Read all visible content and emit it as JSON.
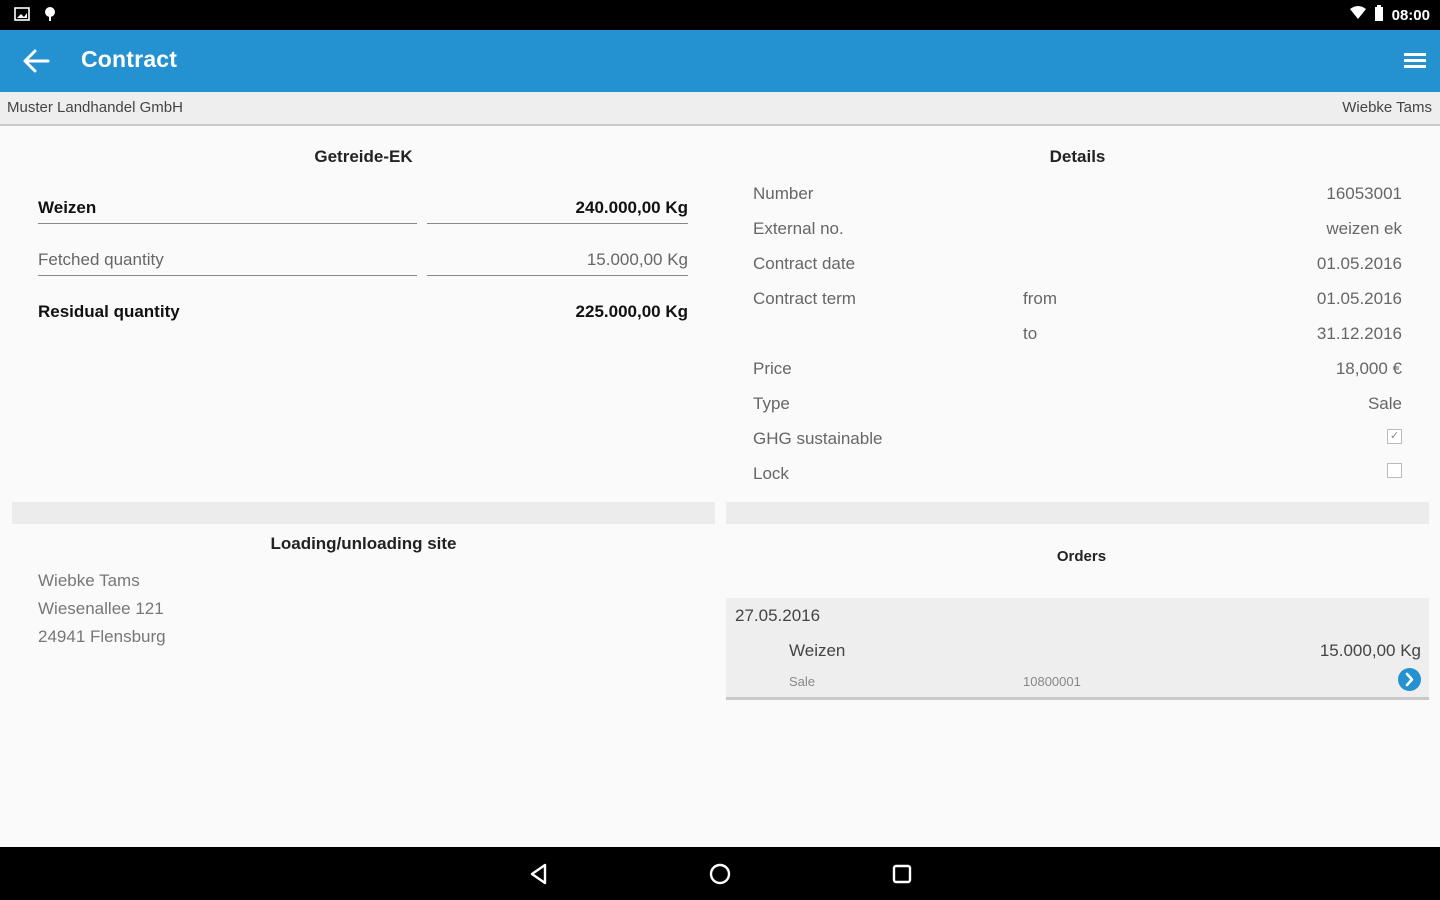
{
  "status_bar": {
    "time": "08:00"
  },
  "app_bar": {
    "title": "Contract"
  },
  "sub_header": {
    "company": "Muster Landhandel GmbH",
    "user": "Wiebke Tams"
  },
  "contract": {
    "title": "Getreide-EK",
    "product_label": "Weizen",
    "product_quantity": "240.000,00 Kg",
    "fetched_label": "Fetched quantity",
    "fetched_quantity": "15.000,00 Kg",
    "residual_label": "Residual quantity",
    "residual_quantity": "225.000,00 Kg"
  },
  "details": {
    "title": "Details",
    "number_label": "Number",
    "number_value": "16053001",
    "external_label": "External no.",
    "external_value": "weizen ek",
    "date_label": "Contract date",
    "date_value": "01.05.2016",
    "term_label": "Contract term",
    "from_label": "from",
    "from_value": "01.05.2016",
    "to_label": "to",
    "to_value": "31.12.2016",
    "price_label": "Price",
    "price_value": "18,000 €",
    "type_label": "Type",
    "type_value": "Sale",
    "ghg_label": "GHG sustainable",
    "ghg_checked": true,
    "lock_label": "Lock",
    "lock_checked": false
  },
  "site": {
    "title": "Loading/unloading site",
    "name": "Wiebke Tams",
    "street": "Wiesenallee 121",
    "city": "24941 Flensburg"
  },
  "orders": {
    "title": "Orders",
    "items": [
      {
        "date": "27.05.2016",
        "product": "Weizen",
        "quantity": "15.000,00 Kg",
        "type": "Sale",
        "number": "10800001"
      }
    ]
  },
  "colors": {
    "primary": "#2491d0",
    "status_bar": "#000000",
    "sub_header": "#eeeeee"
  }
}
